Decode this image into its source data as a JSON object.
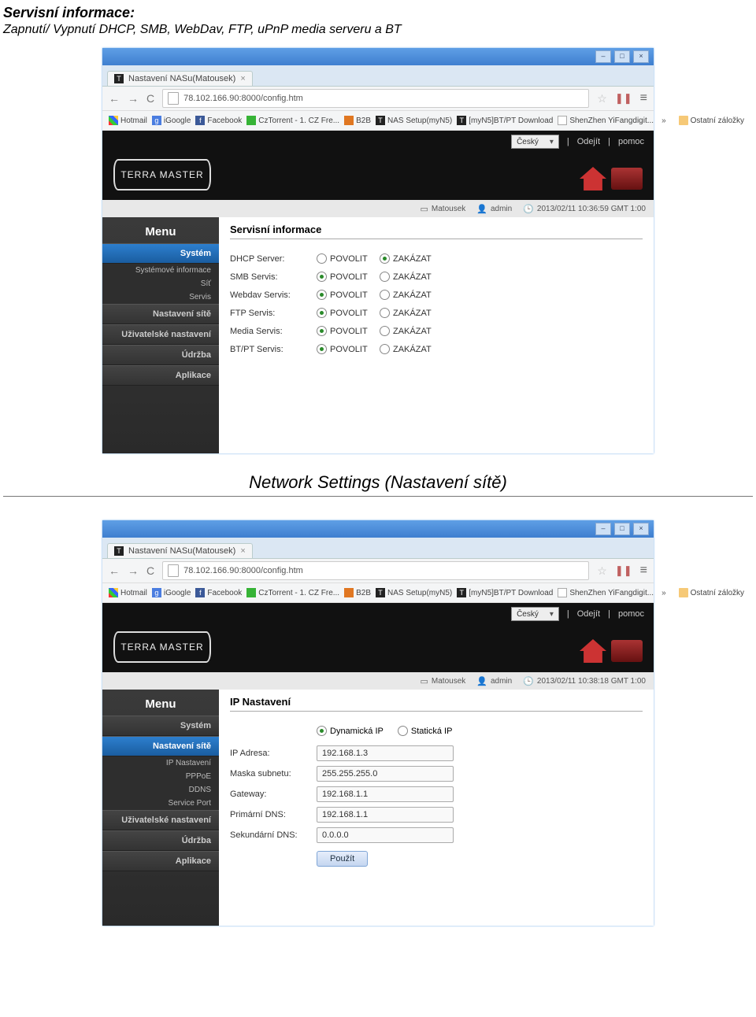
{
  "doc": {
    "heading": "Servisní informace:",
    "subheading": "Zapnutí/ Vypnutí DHCP, SMB, WebDav, FTP, uPnP media serveru a BT",
    "section2_title": "Network Settings (Nastavení sítě)"
  },
  "window": {
    "tab_title": "Nastavení NASu(Matousek)",
    "url": "78.102.166.90:8000/config.htm"
  },
  "bookmarks": {
    "items": [
      {
        "label": "Hotmail"
      },
      {
        "label": "iGoogle"
      },
      {
        "label": "Facebook"
      },
      {
        "label": "CzTorrent - 1. CZ Fre..."
      },
      {
        "label": "B2B"
      },
      {
        "label": "NAS Setup(myN5)"
      },
      {
        "label": "[myN5]BT/PT Download"
      },
      {
        "label": "ShenZhen YiFangdigit..."
      }
    ],
    "overflow": "Ostatní záložky"
  },
  "app_top": {
    "lang": "Český",
    "logout": "Odejít",
    "help": "pomoc"
  },
  "status": {
    "device": "Matousek",
    "user": "admin",
    "time1": "2013/02/11 10:36:59 GMT 1:00",
    "time2": "2013/02/11 10:38:18 GMT 1:00"
  },
  "sidebar": {
    "menu_title": "Menu",
    "items": {
      "system": "Systém",
      "sysinfo": "Systémové informace",
      "net": "Síť",
      "service": "Servis",
      "netset": "Nastavení sítě",
      "ipset": "IP Nastavení",
      "pppoe": "PPPoE",
      "ddns": "DDNS",
      "sport": "Service Port",
      "userset": "Uživatelské nastavení",
      "maint": "Údržba",
      "apps": "Aplikace"
    }
  },
  "screen1": {
    "title": "Servisní informace",
    "opt_enable": "POVOLIT",
    "opt_disable": "ZAKÁZAT",
    "rows": [
      {
        "label": "DHCP Server:",
        "selected": "disable"
      },
      {
        "label": "SMB Servis:",
        "selected": "enable"
      },
      {
        "label": "Webdav Servis:",
        "selected": "enable"
      },
      {
        "label": "FTP Servis:",
        "selected": "enable"
      },
      {
        "label": "Media Servis:",
        "selected": "enable"
      },
      {
        "label": "BT/PT Servis:",
        "selected": "enable"
      }
    ]
  },
  "screen2": {
    "title": "IP Nastavení",
    "dyn": "Dynamická IP",
    "stat": "Statická IP",
    "apply": "Použít",
    "rows": [
      {
        "label": "IP Adresa:",
        "value": "192.168.1.3"
      },
      {
        "label": "Maska subnetu:",
        "value": "255.255.255.0"
      },
      {
        "label": "Gateway:",
        "value": "192.168.1.1"
      },
      {
        "label": "Primární DNS:",
        "value": "192.168.1.1"
      },
      {
        "label": "Sekundární DNS:",
        "value": "0.0.0.0"
      }
    ]
  }
}
